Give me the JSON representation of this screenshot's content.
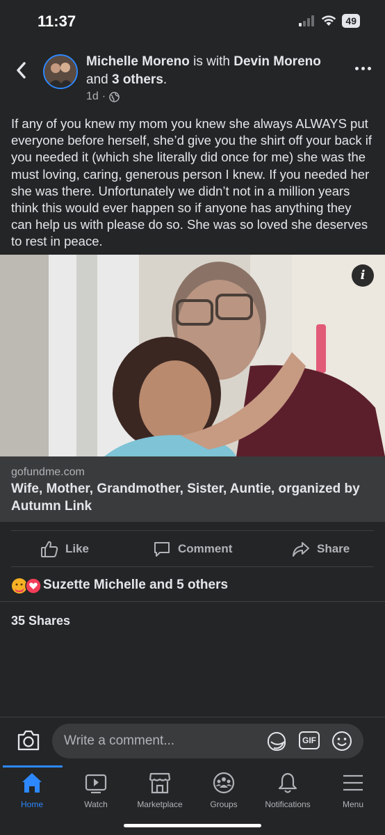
{
  "status": {
    "time": "11:37",
    "battery": "49"
  },
  "post": {
    "author": "Michelle Moreno",
    "with_text": " is with ",
    "tagged": "Devin Moreno",
    "and_text": "and ",
    "others": "3 others",
    "period": ".",
    "time_ago": "1d",
    "separator": "·",
    "text": "If any of you knew my mom you knew she always ALWAYS put everyone before herself, she’d give you the shirt off your back if you needed it (which she literally did once for me) she was the must loving, caring, generous person I knew. If you needed her she was there. Unfortunately we didn’t not in a million years think this would ever happen so if anyone has anything they can help us with please do so. She was so loved she deserves to rest in peace."
  },
  "link": {
    "domain": "gofundme.com",
    "title": "Wife, Mother, Grandmother, Sister, Auntie, organized by Autumn Link",
    "info_glyph": "i"
  },
  "actions": {
    "like": "Like",
    "comment": "Comment",
    "share": "Share"
  },
  "reactions": {
    "summary": "Suzette Michelle and 5 others"
  },
  "shares": "35 Shares",
  "comment_box": {
    "placeholder": "Write a comment...",
    "gif": "GIF"
  },
  "tabs": [
    {
      "label": "Home",
      "icon": "home-icon",
      "active": true
    },
    {
      "label": "Watch",
      "icon": "watch-icon"
    },
    {
      "label": "Marketplace",
      "icon": "marketplace-icon"
    },
    {
      "label": "Groups",
      "icon": "groups-icon"
    },
    {
      "label": "Notifications",
      "icon": "bell-icon"
    },
    {
      "label": "Menu",
      "icon": "menu-icon"
    }
  ],
  "colors": {
    "accent": "#2d88ff",
    "background": "#242526",
    "card": "#3a3b3c",
    "text": "#e4e6eb",
    "muted": "#b0b3b8"
  }
}
